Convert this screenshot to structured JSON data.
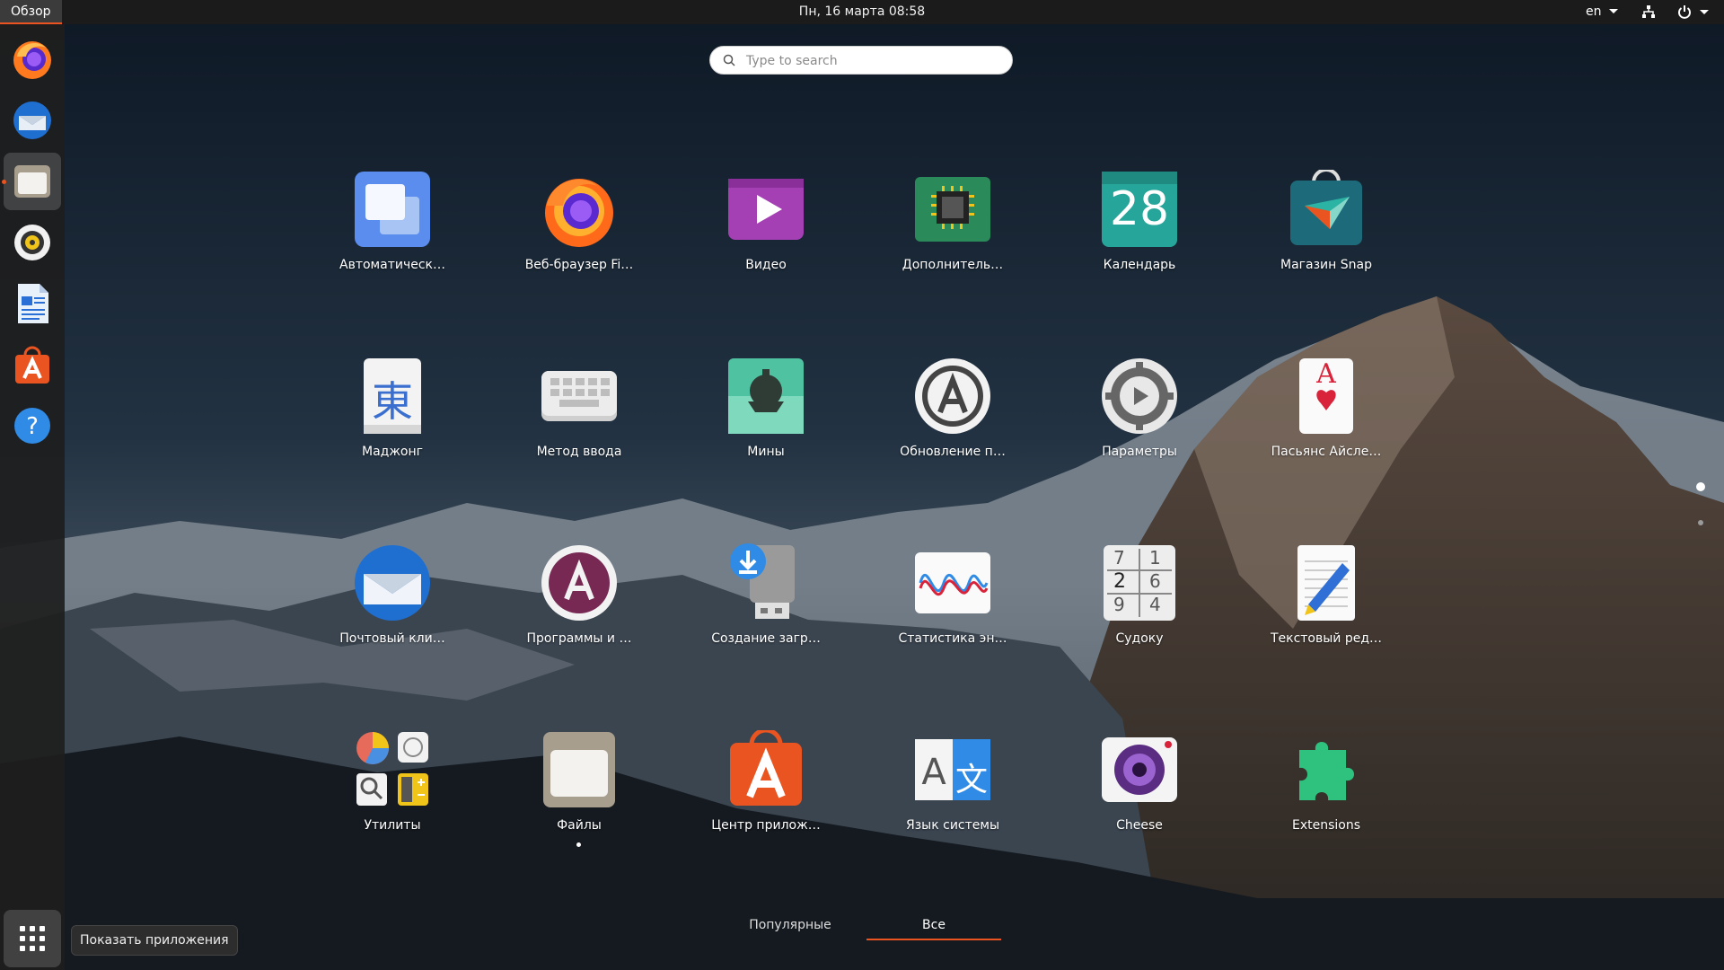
{
  "topbar": {
    "activities": "Обзор",
    "clock": "Пн, 16 марта  08:58",
    "lang": "en"
  },
  "search": {
    "placeholder": "Type to search"
  },
  "dock": {
    "items": [
      "firefox",
      "thunderbird",
      "files",
      "rhythmbox",
      "libreoffice-writer",
      "software-center",
      "help"
    ]
  },
  "apps": [
    {
      "label": "Автоматическ…",
      "icon": "window-icon"
    },
    {
      "label": "Веб-браузер Fi…",
      "icon": "firefox-icon"
    },
    {
      "label": "Видео",
      "icon": "play-icon"
    },
    {
      "label": "Дополнитель…",
      "icon": "chip-icon"
    },
    {
      "label": "Календарь",
      "icon": "calendar-icon",
      "day": "28"
    },
    {
      "label": "Магазин Snap",
      "icon": "snap-store-icon"
    },
    {
      "label": "Маджонг",
      "icon": "mahjong-icon",
      "glyph": "東"
    },
    {
      "label": "Метод ввода",
      "icon": "keyboard-icon"
    },
    {
      "label": "Мины",
      "icon": "mines-icon"
    },
    {
      "label": "Обновление п…",
      "icon": "software-updater-icon"
    },
    {
      "label": "Параметры",
      "icon": "settings-gear-icon"
    },
    {
      "label": "Пасьянс Айсле…",
      "icon": "card-icon",
      "glyph": "A"
    },
    {
      "label": "Почтовый кли…",
      "icon": "thunderbird-icon"
    },
    {
      "label": "Программы и …",
      "icon": "software-properties-icon"
    },
    {
      "label": "Создание загр…",
      "icon": "usb-creator-icon"
    },
    {
      "label": "Статистика эн…",
      "icon": "power-stats-icon"
    },
    {
      "label": "Судоку",
      "icon": "sudoku-icon",
      "digits": [
        "7",
        "1",
        "2",
        "6",
        "9",
        "4"
      ]
    },
    {
      "label": "Текстовый ред…",
      "icon": "text-editor-icon"
    },
    {
      "label": "Утилиты",
      "icon": "utilities-folder-icon"
    },
    {
      "label": "Файлы",
      "icon": "files-icon"
    },
    {
      "label": "Центр прилож…",
      "icon": "app-center-icon"
    },
    {
      "label": "Язык системы",
      "icon": "language-icon",
      "glyph_a": "A",
      "glyph_b": "文"
    },
    {
      "label": "Cheese",
      "icon": "cheese-camera-icon"
    },
    {
      "label": "Extensions",
      "icon": "puzzle-icon"
    }
  ],
  "switcher": {
    "frequent": "Популярные",
    "all": "Все"
  },
  "tooltip": "Показать приложения",
  "colors": {
    "accent": "#e95420"
  }
}
